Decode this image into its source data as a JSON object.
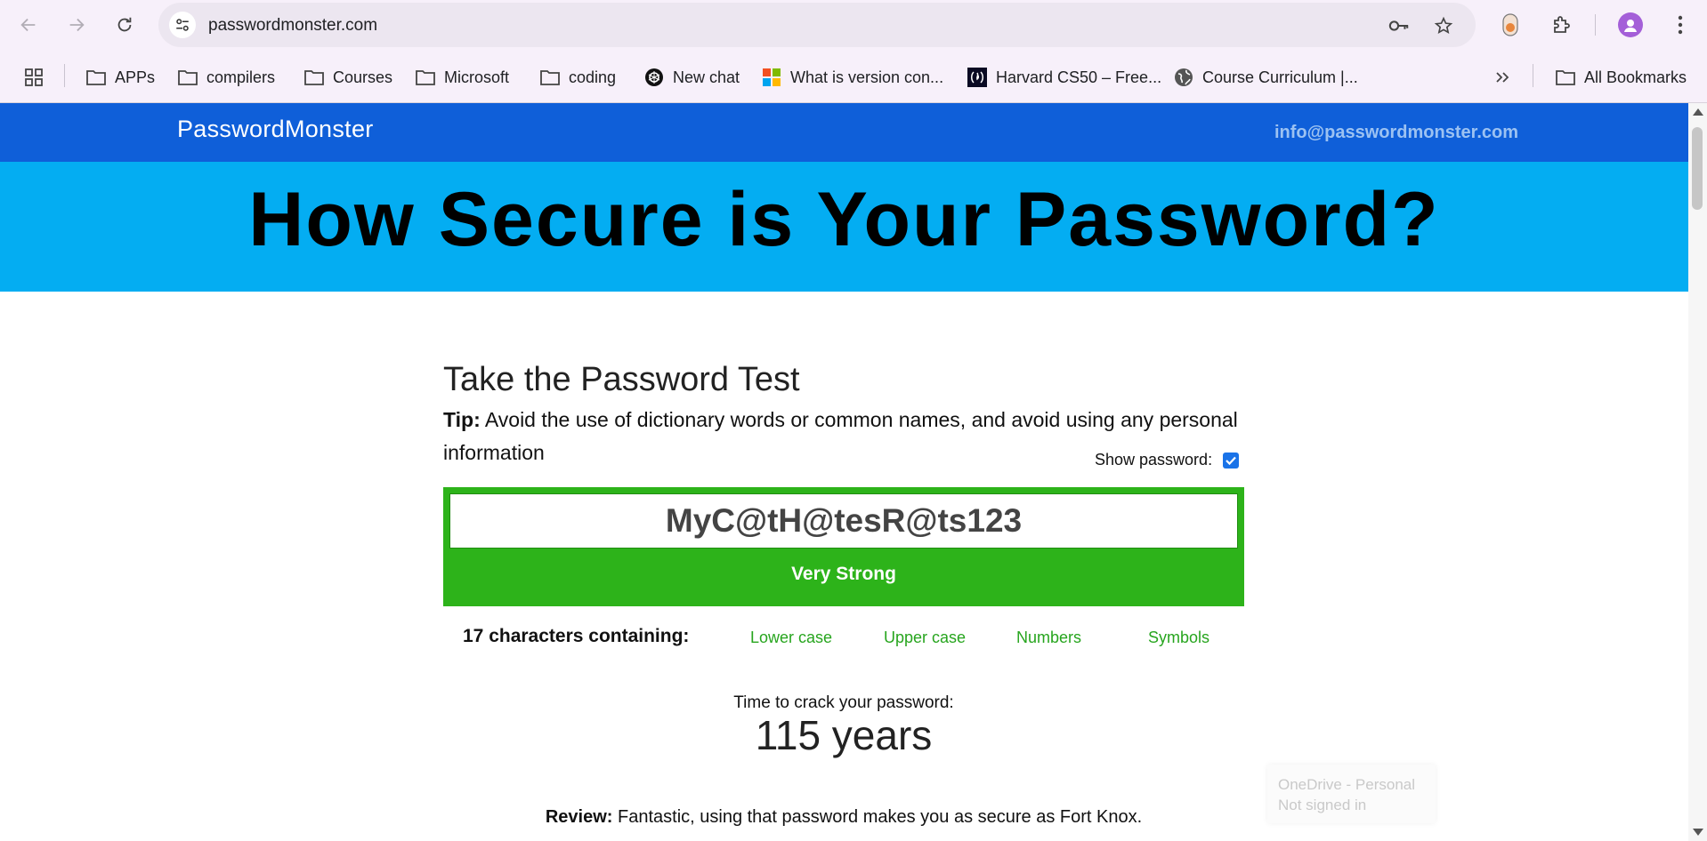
{
  "browser": {
    "url": "passwordmonster.com",
    "bookmarks": [
      {
        "label": "APPs",
        "icon": "folder-icon"
      },
      {
        "label": "compilers",
        "icon": "folder-icon"
      },
      {
        "label": "Courses",
        "icon": "folder-icon"
      },
      {
        "label": "Microsoft",
        "icon": "folder-icon"
      },
      {
        "label": "coding",
        "icon": "folder-icon"
      },
      {
        "label": "New chat",
        "icon": "chatgpt-icon"
      },
      {
        "label": "What is version con...",
        "icon": "microsoft-logo-icon"
      },
      {
        "label": "Harvard CS50 – Free...",
        "icon": "freecodecamp-icon"
      },
      {
        "label": "Course Curriculum |...",
        "icon": "globe-icon"
      }
    ],
    "all_bookmarks_label": "All Bookmarks"
  },
  "site": {
    "brand": "PasswordMonster",
    "email": "info@passwordmonster.com",
    "hero_title": "How Secure is Your Password?"
  },
  "test": {
    "title": "Take the Password Test",
    "tip_label": "Tip:",
    "tip_text": " Avoid the use of dictionary words or common names, and avoid using any personal information",
    "show_password_label": "Show password:",
    "show_password_checked": true,
    "password_value": "MyC@tH@tesR@ts123",
    "strength_label": "Very Strong",
    "strength_color": "#2db31a",
    "characters_summary": "17 characters containing:",
    "character_types": [
      "Lower case",
      "Upper case",
      "Numbers",
      "Symbols"
    ],
    "crack_label": "Time to crack your password:",
    "crack_time": "115 years",
    "review_label": "Review:",
    "review_text": " Fantastic, using that password makes you as secure as Fort Knox."
  },
  "onedrive": {
    "line1": "OneDrive - Personal",
    "line2": "Not signed in"
  },
  "colors": {
    "header_blue": "#0f5fd9",
    "hero_cyan": "#04adf2",
    "accent_green": "#27a51e"
  }
}
